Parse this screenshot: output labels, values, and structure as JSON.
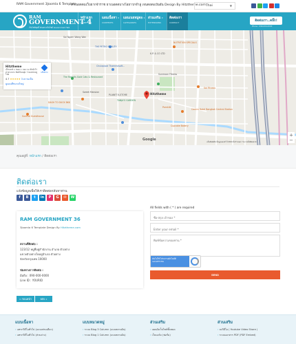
{
  "topbar": {
    "site_name": "RAM Government 3Joomla 6 Template",
    "marquee": "ยาเนอดดมเว็บยากจ้าราช ยาเนอดดบางโอยาวกจำลู่ เจนดอดแบ้นอัน Design By Hitztheme.com",
    "language": "Thai",
    "social_colors": [
      "#3b5998",
      "#3fb44a",
      "#1da1f2",
      "#d32f2f",
      "#1e88e5"
    ]
  },
  "header": {
    "logo_top": "RAM",
    "logo_main": "GOVERNMENT",
    "logo_num": "4",
    "logo_sub": "เว็บไซต์ชุดนี้ ตัวอย่างเว็บไซต์ Government ของ",
    "nav": [
      {
        "label": "หน้าแรก",
        "sub": "HOME",
        "active": false
      },
      {
        "label": "แผนเนื้อหา",
        "sub": "CONTENTS",
        "active": false
      },
      {
        "label": "แผนเนยหมู่ตอ",
        "sub": "CATEGORIES",
        "active": false
      },
      {
        "label": "ส่วนเสริม",
        "sub": "EXTENSIONS",
        "active": false
      },
      {
        "label": "ติดต่อเรา",
        "sub": "CONTACT",
        "active": true
      }
    ],
    "cta": "ติดต่อเรา..คลิ๊ก!",
    "cta_sub": "Phone : 090-XXX-XXXX"
  },
  "map": {
    "card_title": "Hitztheme",
    "card_address": "เอ็กเจทช์ 1 ซอย 1 บอง 1อ ฟ้าคั่งโร่ หวยวงบาง ลัยต์ก้อนยุ่ย ว่างแหล่งจตู ไทย",
    "card_rating": "4.7",
    "card_stars": "★★★★★",
    "card_reviews": "3 ความเห็น",
    "card_link": "ดูแผนที่ขนาดใหญ่",
    "card_dir": "เส้นทาง",
    "pin_label": "Hitztheme",
    "labels": {
      "petrolia": "THE PETRO BEAUTY",
      "kp": "K.P. & CO LTD",
      "nutrition": "NUTRITION SPECIALS",
      "sunmoon": "Sunmoon Fitness",
      "soi": "Soi Ngam Wong Wan",
      "chula": "Chulapipat Thammasoft...",
      "rabbit": "The Rabbits Gold Cats & Restaurant",
      "dash": "DASH TO DUCK BKK",
      "sunrise": "Sunrise Guesthouse",
      "mansion": "Sweet Mansion",
      "planet": "PLANET K-STORE",
      "tanja": "TANJA'S GARDEN",
      "centrah": "Centra Hotel Bangkok Central Station",
      "cupcake": "Cupcake Bakery",
      "pkwt": "Pornkitt",
      "fitness": "Sai Fitness",
      "google": "Google",
      "footer": "แป้นพิมพ์ลัด   ข้อมูลแผนที่ ©2024   ข้อกำหนด   รายงานข้อผิดพลาด"
    }
  },
  "breadcrumb": {
    "here": "คุณอยู่ที่:",
    "home": "หน้าแรก",
    "sep": "/",
    "current": "ติดต่อเรา"
  },
  "page": {
    "title": "ติดต่อเรา",
    "subtitle": "แจ้งข้อมูลเพื่อให้เราติดต่อกลับหาท่าน",
    "share_colors": [
      "#3b5998",
      "#3b5998",
      "#1da1f2",
      "#0077b5",
      "#e1306c",
      "#dd4b39",
      "#e95a2e",
      "#25d366"
    ],
    "share_glyphs": [
      "f",
      "B",
      "t",
      "in",
      "P",
      "G",
      "✉",
      "W"
    ]
  },
  "contact_card": {
    "name": "RAM GOVERNMENT 36",
    "tagline": "3Joomla 6 Template Design By",
    "tagline_link": "Hitztheme.com",
    "address_heading": "สถานที่ติดต่อ :",
    "address_lines": [
      "123/12 หมู่ที่อยู่สำนักงาน อำเภอ ตัวอย่าง",
      "แขวงตัวอย่างใดอยู่อำเภอ ตัวอย่าง",
      "จังหวัดกรุงเทพ 10000"
    ],
    "contact_heading": "ช่องทางการติดต่อ :",
    "phone": "มือถือ : 090-000-0000",
    "line": "Line ID : YOURID"
  },
  "pagination": {
    "prev": "« ก่อนหน้า",
    "next": "หลัง »"
  },
  "form": {
    "required_note": "All fields with ( * ) are required",
    "name_placeholder": "ชื่อ-สกุล เจ้าของ *",
    "email_placeholder": "Enter your email *",
    "message_placeholder": "พิมพ์ข้อความของท่าน *",
    "recaptcha": "ฉันไม่ใช่โปรแกรมอัตโนมัติ reCAPTCHA",
    "send": "SEND"
  },
  "footer": {
    "columns": [
      {
        "title": "แบบเนื้อหา",
        "items": [
          "แทรกวิดีโอทั่วไป (แบบเฟรมเดียว)",
          "แทรกวิดีโอทั่วไป (ส่วนล่าง)"
        ]
      },
      {
        "title": "แบบหมวดหมู่",
        "items": [
          "ระบบ Blog 3 Column (แบบหลายอัน)",
          "ระบบ Blog 1 Column (แบบหลายอัน)"
        ]
      },
      {
        "title": "ส่วนเสริม",
        "items": [
          "แผนผังเว็บไซต์ทั้งหมด",
          "เว็บบอร์ด (ฟอรั่ม)"
        ]
      },
      {
        "title": "ส่วนเสริม",
        "items": [
          "ลงวิดีโอ ( Youtube Video Share )",
          "ระบบเอกสาร PDF (PDF Embed)"
        ]
      }
    ]
  }
}
